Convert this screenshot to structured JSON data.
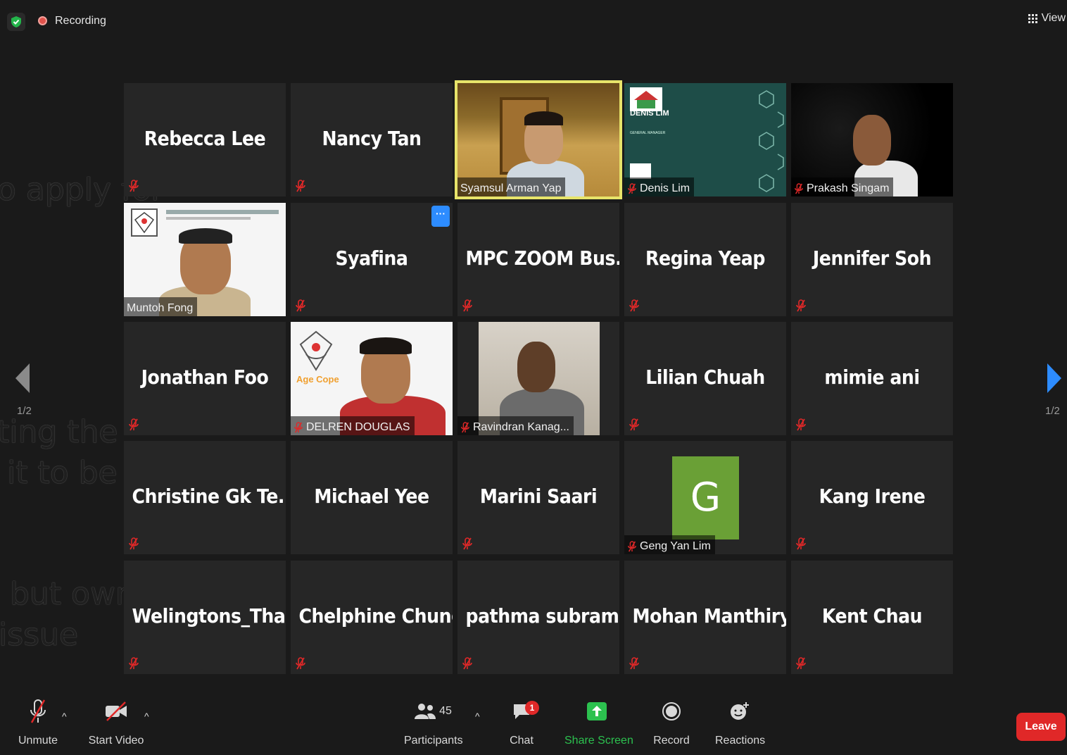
{
  "topbar": {
    "recording_label": "Recording",
    "view_label": "View"
  },
  "background_text": {
    "line1": "o apply for",
    "line2": "ting the",
    "line3": "it to be more",
    "line4": "but owner of",
    "line5": "issue"
  },
  "participants": [
    {
      "name": "Rebecca Lee",
      "video": false,
      "muted": true
    },
    {
      "name": "Nancy Tan",
      "video": false,
      "muted": true
    },
    {
      "name": "Syamsul Arman Yap",
      "video": true,
      "muted": false,
      "active_speaker": true
    },
    {
      "name": "Denis Lim",
      "video": true,
      "muted": true,
      "card_title": "DENIS LIM",
      "card_subtitle": "GENERAL MANAGER"
    },
    {
      "name": "Prakash Singam",
      "video": true,
      "muted": true
    },
    {
      "name": "Muntoh Fong",
      "video": true,
      "muted": false
    },
    {
      "name": "Syafina",
      "video": false,
      "muted": true
    },
    {
      "name": "MPC ZOOM Bus...",
      "video": false,
      "muted": true
    },
    {
      "name": "Regina Yeap",
      "video": false,
      "muted": true
    },
    {
      "name": "Jennifer Soh",
      "video": false,
      "muted": true
    },
    {
      "name": "Jonathan Foo",
      "video": false,
      "muted": true
    },
    {
      "name": "DELREN DOUGLAS",
      "video": true,
      "muted": true
    },
    {
      "name": "Ravindran Kanag...",
      "video": true,
      "muted": true
    },
    {
      "name": "Lilian Chuah",
      "video": false,
      "muted": true
    },
    {
      "name": "mimie ani",
      "video": false,
      "muted": true
    },
    {
      "name": "Christine Gk Te...",
      "video": false,
      "muted": true
    },
    {
      "name": "Michael Yee",
      "video": false,
      "muted": false
    },
    {
      "name": "Marini Saari",
      "video": false,
      "muted": true
    },
    {
      "name": "Geng Yan Lim",
      "video": false,
      "muted": true,
      "avatar_letter": "G"
    },
    {
      "name": "Kang Irene",
      "video": false,
      "muted": true
    },
    {
      "name": "Welingtons_Tha...",
      "video": false,
      "muted": true
    },
    {
      "name": "Chelphine Chung",
      "video": false,
      "muted": true
    },
    {
      "name": "pathma  subram...",
      "video": false,
      "muted": true
    },
    {
      "name": "Mohan Manthiry",
      "video": false,
      "muted": true
    },
    {
      "name": "Kent Chau",
      "video": false,
      "muted": true
    }
  ],
  "logos": {
    "agecope_brand": "Age Cope"
  },
  "pagination": {
    "left": "1/2",
    "right": "1/2"
  },
  "toolbar": {
    "unmute": "Unmute",
    "start_video": "Start Video",
    "participants": "Participants",
    "participant_count": "45",
    "chat": "Chat",
    "chat_badge": "1",
    "share_screen": "Share Screen",
    "record": "Record",
    "reactions": "Reactions",
    "leave": "Leave"
  },
  "colors": {
    "active_speaker": "#e7e46a",
    "share_green": "#2cc14f",
    "leave_red": "#e02828",
    "more_blue": "#2d8cff",
    "avatar_green": "#6aa036",
    "mute_red": "#e02828"
  }
}
